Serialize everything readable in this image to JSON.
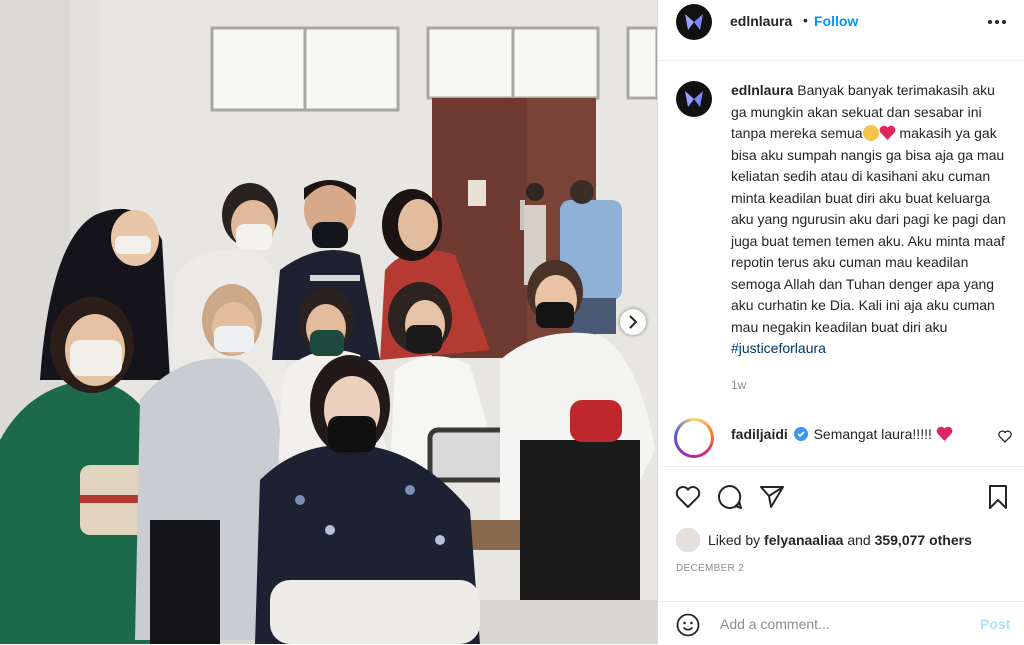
{
  "post": {
    "author": {
      "username": "edlnlaura",
      "separator": "•",
      "follow_label": "Follow"
    },
    "caption": {
      "username": "edlnlaura",
      "text_part1": "Banyak banyak terimakasih aku ga mungkin akan sekuat dan sesabar ini tanpa mereka semua",
      "text_part2": " makasih ya gak bisa aku sumpah nangis ga bisa aja ga mau keliatan sedih atau di kasihani aku cuman minta keadilan buat diri aku buat keluarga aku yang ngurusin aku dari pagi ke pagi dan juga buat temen temen aku. Aku minta maaf repotin terus aku cuman mau keadilan semoga Allah dan Tuhan denger apa yang aku curhatin ke Dia. Kali ini aja aku cuman mau negakin keadilan buat diri aku ",
      "hashtag": "#justiceforlaura",
      "time_ago": "1w"
    },
    "comments": [
      {
        "username": "fadiljaidi",
        "verified": true,
        "text": "Semangat laura!!!!!"
      }
    ],
    "likes": {
      "prefix": "Liked by",
      "liker": "felyanaaliaa",
      "middle": "and",
      "count": "359,077 others"
    },
    "date": "DECEMBER 2",
    "comment_input": {
      "placeholder": "Add a comment...",
      "post_label": "Post"
    }
  },
  "icons": {
    "more": "more-horizontal-icon",
    "like": "heart-outline-icon",
    "comment": "comment-bubble-icon",
    "share": "paper-plane-icon",
    "save": "bookmark-icon",
    "emoji": "smiley-icon",
    "next": "chevron-right-icon",
    "verified": "verified-badge-icon"
  },
  "colors": {
    "link_blue": "#0095f6",
    "hashtag_blue": "#00376b",
    "heart_red": "#ed4956",
    "muted": "#8e8e8e",
    "post_disabled": "#b2dffc"
  }
}
